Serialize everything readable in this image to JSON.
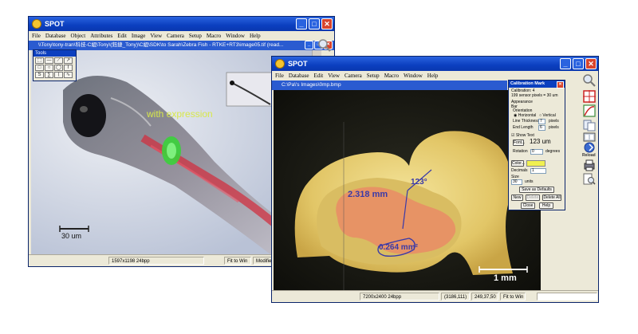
{
  "left_window": {
    "title": "SPOT",
    "menu": [
      "File",
      "Database",
      "Object",
      "Attributes",
      "Edit",
      "Image",
      "View",
      "Camera",
      "Setup",
      "Macro",
      "Window",
      "Help"
    ],
    "doc_title": "\\\\Tony\\tony-tran\\科技-C組\\Tony\\(鈺捷_Tony)\\C組\\SDK\\to Sarah\\Zebra Fish - RTKE+RT3\\image05.tif (read...",
    "annotation": "with expression",
    "scale_label": "30 um",
    "status": {
      "size": "1597x1198 24bpp",
      "fit": "Fit to Win",
      "modified": "Modified"
    },
    "tools_title": "Tools",
    "tool_glyphs": [
      "⬚",
      "—",
      "⟋",
      "↗",
      "□",
      "○",
      "◯",
      "⌇",
      "S",
      "∑",
      "⟨",
      "∿"
    ]
  },
  "right_window": {
    "title": "SPOT",
    "menu": [
      "File",
      "Database",
      "Edit",
      "View",
      "Camera",
      "Setup",
      "Macro",
      "Window",
      "Help"
    ],
    "doc_title": "C:\\Pa\\'s Images\\0mp.bmp",
    "measure_length": "2.318 mm",
    "measure_angle": "123°",
    "measure_area": "0.264 mm²",
    "scale_label": "1 mm",
    "status": {
      "size": "7200x2400 24bpp",
      "coords": "(3186,111)",
      "rgb": "249,37,50",
      "fit": "Fit to Win"
    },
    "side_labels": [
      "Reload"
    ]
  },
  "calibration": {
    "title": "Calibration Mark",
    "calibration_line": "Calibration: 4",
    "ratio_line": "199 sensor pixels = 30 um",
    "appearance": "Appearance",
    "bar": "Bar",
    "orientation": "Orientation",
    "horizontal": "Horizontal",
    "vertical": "Vertical",
    "line_thickness_label": "Line Thickness",
    "line_thickness_value": "7",
    "end_length_label": "End Length",
    "end_length_value": "6",
    "pixels": "pixels",
    "show_text": "Show Text",
    "font_button": "Font...",
    "font_preview": "123 um",
    "rotation_label": "Rotation",
    "rotation_value": "0",
    "degrees": "degrees",
    "color_button": "Color...",
    "decimals_label": "Decimals",
    "decimals_value": "1",
    "size_label": "Size",
    "size_value": "30",
    "units": "units",
    "save_defaults": "Save as Defaults",
    "new": "New",
    "delete": "Delete",
    "delete_all": "Delete All",
    "close": "Close",
    "help": "Help"
  },
  "colors": {
    "titlebar": "#0b3fbf",
    "annotation_green": "#d8e84a",
    "measure_blue": "#3a3aa8",
    "calib_yellow": "#f0f050"
  }
}
